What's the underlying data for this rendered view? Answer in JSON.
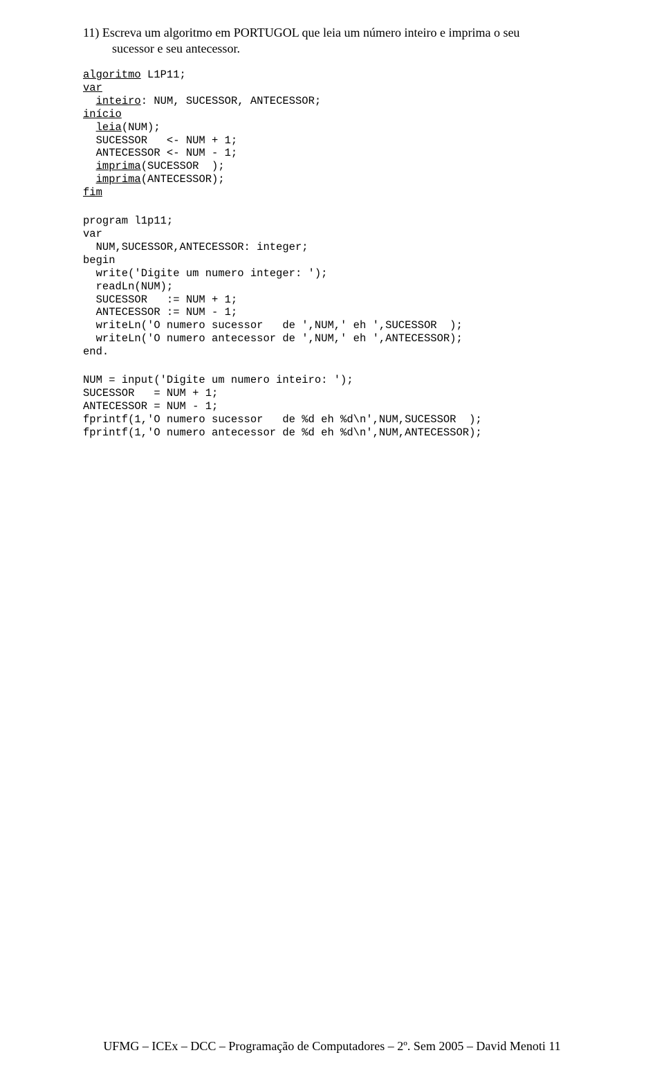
{
  "question": {
    "number": "11)",
    "line1": "Escreva um algoritmo em PORTUGOL que leia um número inteiro e imprima o seu",
    "line2": "sucessor e seu antecessor."
  },
  "portugol": {
    "kw_algoritmo": "algoritmo",
    "name": " L1P11;",
    "kw_var": "var",
    "decl_inteiro_kw": "inteiro",
    "decl_inteiro_rest": ": NUM, SUCESSOR, ANTECESSOR;",
    "kw_inicio": "início",
    "leia_kw": "leia",
    "leia_rest": "(NUM);",
    "l_sucessor": "  SUCESSOR   <- NUM + 1;",
    "l_antecessor": "  ANTECESSOR <- NUM - 1;",
    "imp1_kw": "imprima",
    "imp1_rest": "(SUCESSOR  );",
    "imp2_kw": "imprima",
    "imp2_rest": "(ANTECESSOR);",
    "kw_fim": "fim"
  },
  "pascal": {
    "l1": "program l1p11;",
    "l2": "var",
    "l3": "  NUM,SUCESSOR,ANTECESSOR: integer;",
    "l4": "begin",
    "l5": "  write('Digite um numero integer: ');",
    "l6": "  readLn(NUM);",
    "l7": "  SUCESSOR   := NUM + 1;",
    "l8": "  ANTECESSOR := NUM - 1;",
    "l9": "  writeLn('O numero sucessor   de ',NUM,' eh ',SUCESSOR  );",
    "l10": "  writeLn('O numero antecessor de ',NUM,' eh ',ANTECESSOR);",
    "l11": "end."
  },
  "matlab": {
    "l1": "NUM = input('Digite um numero inteiro: ');",
    "l2": "SUCESSOR   = NUM + 1;",
    "l3": "ANTECESSOR = NUM - 1;",
    "l4": "fprintf(1,'O numero sucessor   de %d eh %d\\n',NUM,SUCESSOR  );",
    "l5": "fprintf(1,'O numero antecessor de %d eh %d\\n',NUM,ANTECESSOR);"
  },
  "footer": "UFMG – ICEx – DCC – Programação de Computadores – 2º. Sem 2005 – David Menoti  11"
}
